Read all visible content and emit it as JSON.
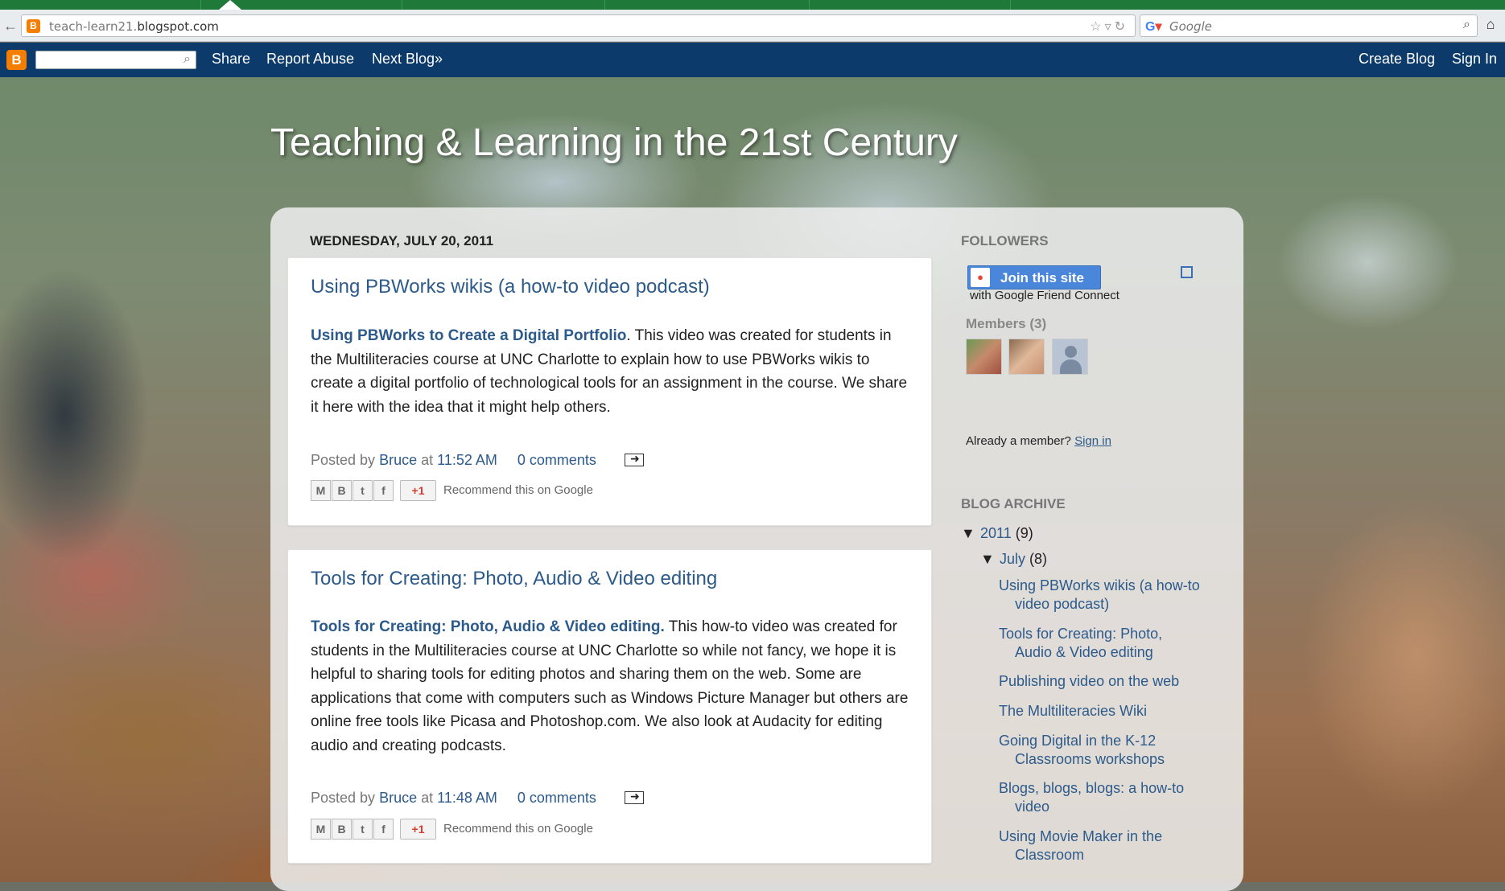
{
  "browser": {
    "url_host": "teach-learn21.",
    "url_domain": "blogspot.com",
    "search_placeholder": "Google"
  },
  "blogger_bar": {
    "share": "Share",
    "report_abuse": "Report Abuse",
    "next_blog": "Next Blog»",
    "create_blog": "Create Blog",
    "sign_in": "Sign In"
  },
  "blog": {
    "title": "Teaching & Learning in the 21st Century",
    "date_header": "WEDNESDAY, JULY 20, 2011"
  },
  "posts": [
    {
      "title": "Using PBWorks wikis (a how-to video podcast)",
      "lead_link": "Using PBWorks to Create a Digital Portfolio",
      "body": ". This video was created for students in the Multiliteracies course at UNC Charlotte to explain how to use PBWorks wikis to create a digital portfolio of technological tools for an assignment in the course. We share it here with the idea that it might help others.",
      "posted_by": "Posted by",
      "author": "Bruce",
      "at": "at",
      "time": "11:52 AM",
      "comments": "0 comments",
      "recommend": "Recommend this on Google",
      "plus_one": "+1"
    },
    {
      "title": "Tools for Creating: Photo, Audio & Video editing",
      "lead_link": "Tools for Creating: Photo, Audio & Video editing.",
      "body": " This how-to video was created for students in the Multiliteracies course at UNC Charlotte so while not fancy, we hope it is helpful to sharing tools for editing photos and sharing them on the web. Some are applications that come with computers such as Windows Picture Manager but others are online free tools like Picasa and Photoshop.com. We also look at Audacity for editing audio and creating podcasts.",
      "posted_by": "Posted by",
      "author": "Bruce",
      "at": "at",
      "time": "11:48 AM",
      "comments": "0 comments",
      "recommend": "Recommend this on Google",
      "plus_one": "+1"
    }
  ],
  "sidebar": {
    "followers_heading": "FOLLOWERS",
    "join_button": "Join this site",
    "with_gfc": "with Google Friend Connect",
    "members": "Members (3)",
    "already_member": "Already a member?",
    "sign_in_link": "Sign in",
    "archive_heading": "BLOG ARCHIVE",
    "year": "2011",
    "year_count": "(9)",
    "month": "July",
    "month_count": "(8)",
    "archive_posts": [
      "Using PBWorks wikis (a how-to video podcast)",
      "Tools for Creating: Photo, Audio & Video editing",
      "Publishing video on the web",
      "The Multiliteracies Wiki",
      "Going Digital in the K-12 Classrooms workshops",
      "Blogs, blogs, blogs: a how-to video",
      "Using Movie Maker in the Classroom"
    ]
  },
  "colors": {
    "blogger_bar": "#0b3a6b",
    "link": "#2c5a8a",
    "tab_strip": "#1f7a3a"
  }
}
